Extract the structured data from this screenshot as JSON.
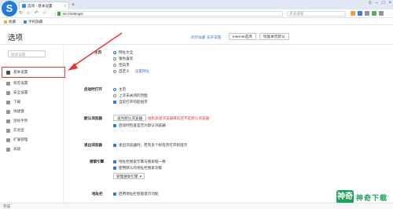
{
  "browser": {
    "tab_title": "选项 - 基本设置",
    "address": "se://settings/",
    "search_placeholder": "点此搜索",
    "bookmarks": [
      "收藏",
      "手机收藏"
    ]
  },
  "colors": {
    "accent": "#2d7be0",
    "highlight": "#e53935",
    "watermark": "#1aa35a"
  },
  "header": {
    "title": "选项",
    "links": [
      "同步收藏",
      "多开设置"
    ],
    "buttons": [
      "Internet选项",
      "恢复本页默认"
    ]
  },
  "sidebar": {
    "search_placeholder": "搜索设置",
    "items": [
      {
        "label": "基本设置",
        "icon": "home-icon",
        "active": true
      },
      {
        "label": "标签设置",
        "icon": "tab-icon"
      },
      {
        "label": "安全设置",
        "icon": "shield-icon"
      },
      {
        "label": "下载",
        "icon": "download-icon"
      },
      {
        "label": "快捷键",
        "icon": "keyboard-icon"
      },
      {
        "label": "鼠标手势",
        "icon": "mouse-icon"
      },
      {
        "label": "实验室",
        "icon": "lab-icon"
      },
      {
        "label": "扩展管理",
        "icon": "puzzle-icon"
      },
      {
        "label": "高级",
        "icon": "gear-icon"
      }
    ]
  },
  "sections": {
    "homepage": {
      "label": "主页",
      "options": [
        "网址大全",
        "猜你喜欢",
        "空白页",
        "自定义"
      ],
      "custom_link": "设置网址"
    },
    "startup": {
      "label": "启动时打开",
      "options": [
        "主页",
        "上次未关闭的页面"
      ],
      "check": "当前打开的起始页"
    },
    "default_browser": {
      "label": "默认浏览器",
      "button": "设为默认浏览器",
      "warning": "搜狗高速浏览器目前还不是默认浏览器",
      "check": "启动时检查是否为默认浏览器"
    },
    "close_browser": {
      "label": "退出浏览器",
      "check": "退出浏览器时，若有多个标签页打开则提示"
    },
    "search_engine": {
      "label": "搜索引擎",
      "checks": [
        "地址栏搜索引擎与搜索框一致",
        "使用默认的地址栏搜索功能"
      ],
      "select": "管理搜索引擎"
    },
    "address_bar": {
      "label": "地址栏",
      "check": "启用地址栏智能提示功能"
    }
  },
  "watermark": {
    "badge": "神奇",
    "text": "神奇下载"
  },
  "statusbar": {
    "text": "完成"
  }
}
